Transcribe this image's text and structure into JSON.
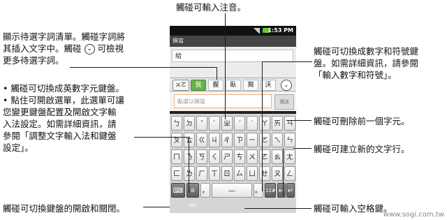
{
  "annotations": {
    "top": "觸碰可輸入注音。",
    "left1_line1": "顯示待選字詞清單。觸碰字詞將",
    "left1_line2": "其插入文字中。觸碰",
    "left1_line2b": "可檢視",
    "left1_line3": "更多待選字詞。",
    "left2_line1": "• 觸碰可切換成英數字元鍵盤。",
    "left2_line2": "• 點住可開啟選單，此選單可讓",
    "left2_line3": "您變更鍵盤配置及開啟文字輸",
    "left2_line4": "入法設定。如需詳細資訊，請",
    "left2_line5": "參閱「調整文字輸入法和鍵盤",
    "left2_line6": "設定」。",
    "bottom_left": "觸碰可切換鍵盤的開啟和關閉。",
    "right1_line1": "觸碰可切換成數字和符號鍵",
    "right1_line2": "盤。如需詳細資訊，請參閱",
    "right1_line3": "「輸入數字和符號」。",
    "right2": "觸碰可刪除前一個字元。",
    "right3": "觸碰可建立新的文字行。",
    "bottom_right": "觸碰可輸入空格鍵。"
  },
  "phone": {
    "status_time": "1:53 PM",
    "title": "撰寫",
    "text_value": "給",
    "cand_x_label": "ㄨㄛ",
    "candidates": [
      "我",
      "握",
      "臥",
      "窩",
      "沃"
    ],
    "more_icon": "chevron-down-icon",
    "compose_placeholder": "點選以撰寫",
    "compose_button": "傳送",
    "row1": [
      "ㄅ",
      "ㄉ",
      "ˇ",
      "ˋ",
      "ㄓ",
      "ˊ",
      "˙",
      "ㄚ",
      "ㄞ",
      "ㄢ"
    ],
    "row2": [
      "ㄆ",
      "ㄊ",
      "ㄍ",
      "ㄐ",
      "ㄔ",
      "ㄗ",
      "ㄧ",
      "ㄛ",
      "ㄟ",
      "ㄣ"
    ],
    "row3": [
      "ㄇ",
      "ㄋ",
      "ㄎ",
      "ㄑ",
      "ㄕ",
      "ㄘ",
      "ㄨ",
      "ㄜ",
      "ㄠ",
      "ㄤ"
    ],
    "row4": [
      "ㄈ",
      "ㄌ",
      "ㄏ",
      "ㄒ",
      "ㄖ",
      "ㄙ",
      "ㄩ",
      "ㄝ",
      "ㄡ",
      "ㄥ"
    ],
    "bottom_keys": {
      "keyboard": "⌨",
      "settings": "⚙ abc",
      "comma": "，",
      "space": "—",
      "period": "。",
      "num": "12#",
      "del": "←",
      "enter": "↵"
    }
  },
  "watermark": "www.sogi.com.tw"
}
